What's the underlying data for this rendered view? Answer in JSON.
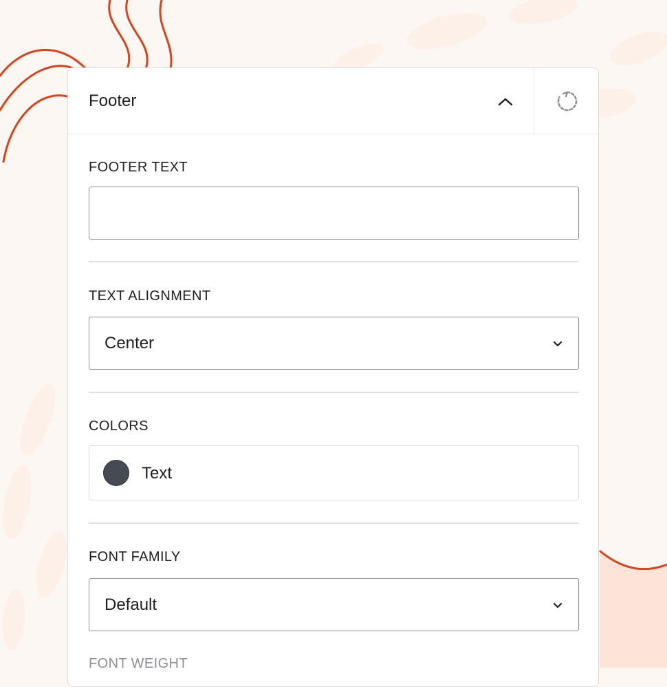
{
  "panel": {
    "title": "Footer"
  },
  "sections": {
    "footer_text": {
      "label": "FOOTER TEXT",
      "value": ""
    },
    "text_alignment": {
      "label": "TEXT ALIGNMENT",
      "selected": "Center"
    },
    "colors": {
      "label": "COLORS",
      "items": [
        {
          "label": "Text",
          "color": "#454a53"
        }
      ]
    },
    "font_family": {
      "label": "FONT FAMILY",
      "selected": "Default"
    },
    "font_weight": {
      "label": "FONT WEIGHT"
    }
  },
  "icons": {
    "collapse": "chevron-up-icon",
    "reset": "reset-icon",
    "dropdown": "chevron-down-icon"
  },
  "theme": {
    "decor_stroke": "#d9421a",
    "background": "#fdf7f4",
    "decor_fill": "#fce4d8"
  }
}
